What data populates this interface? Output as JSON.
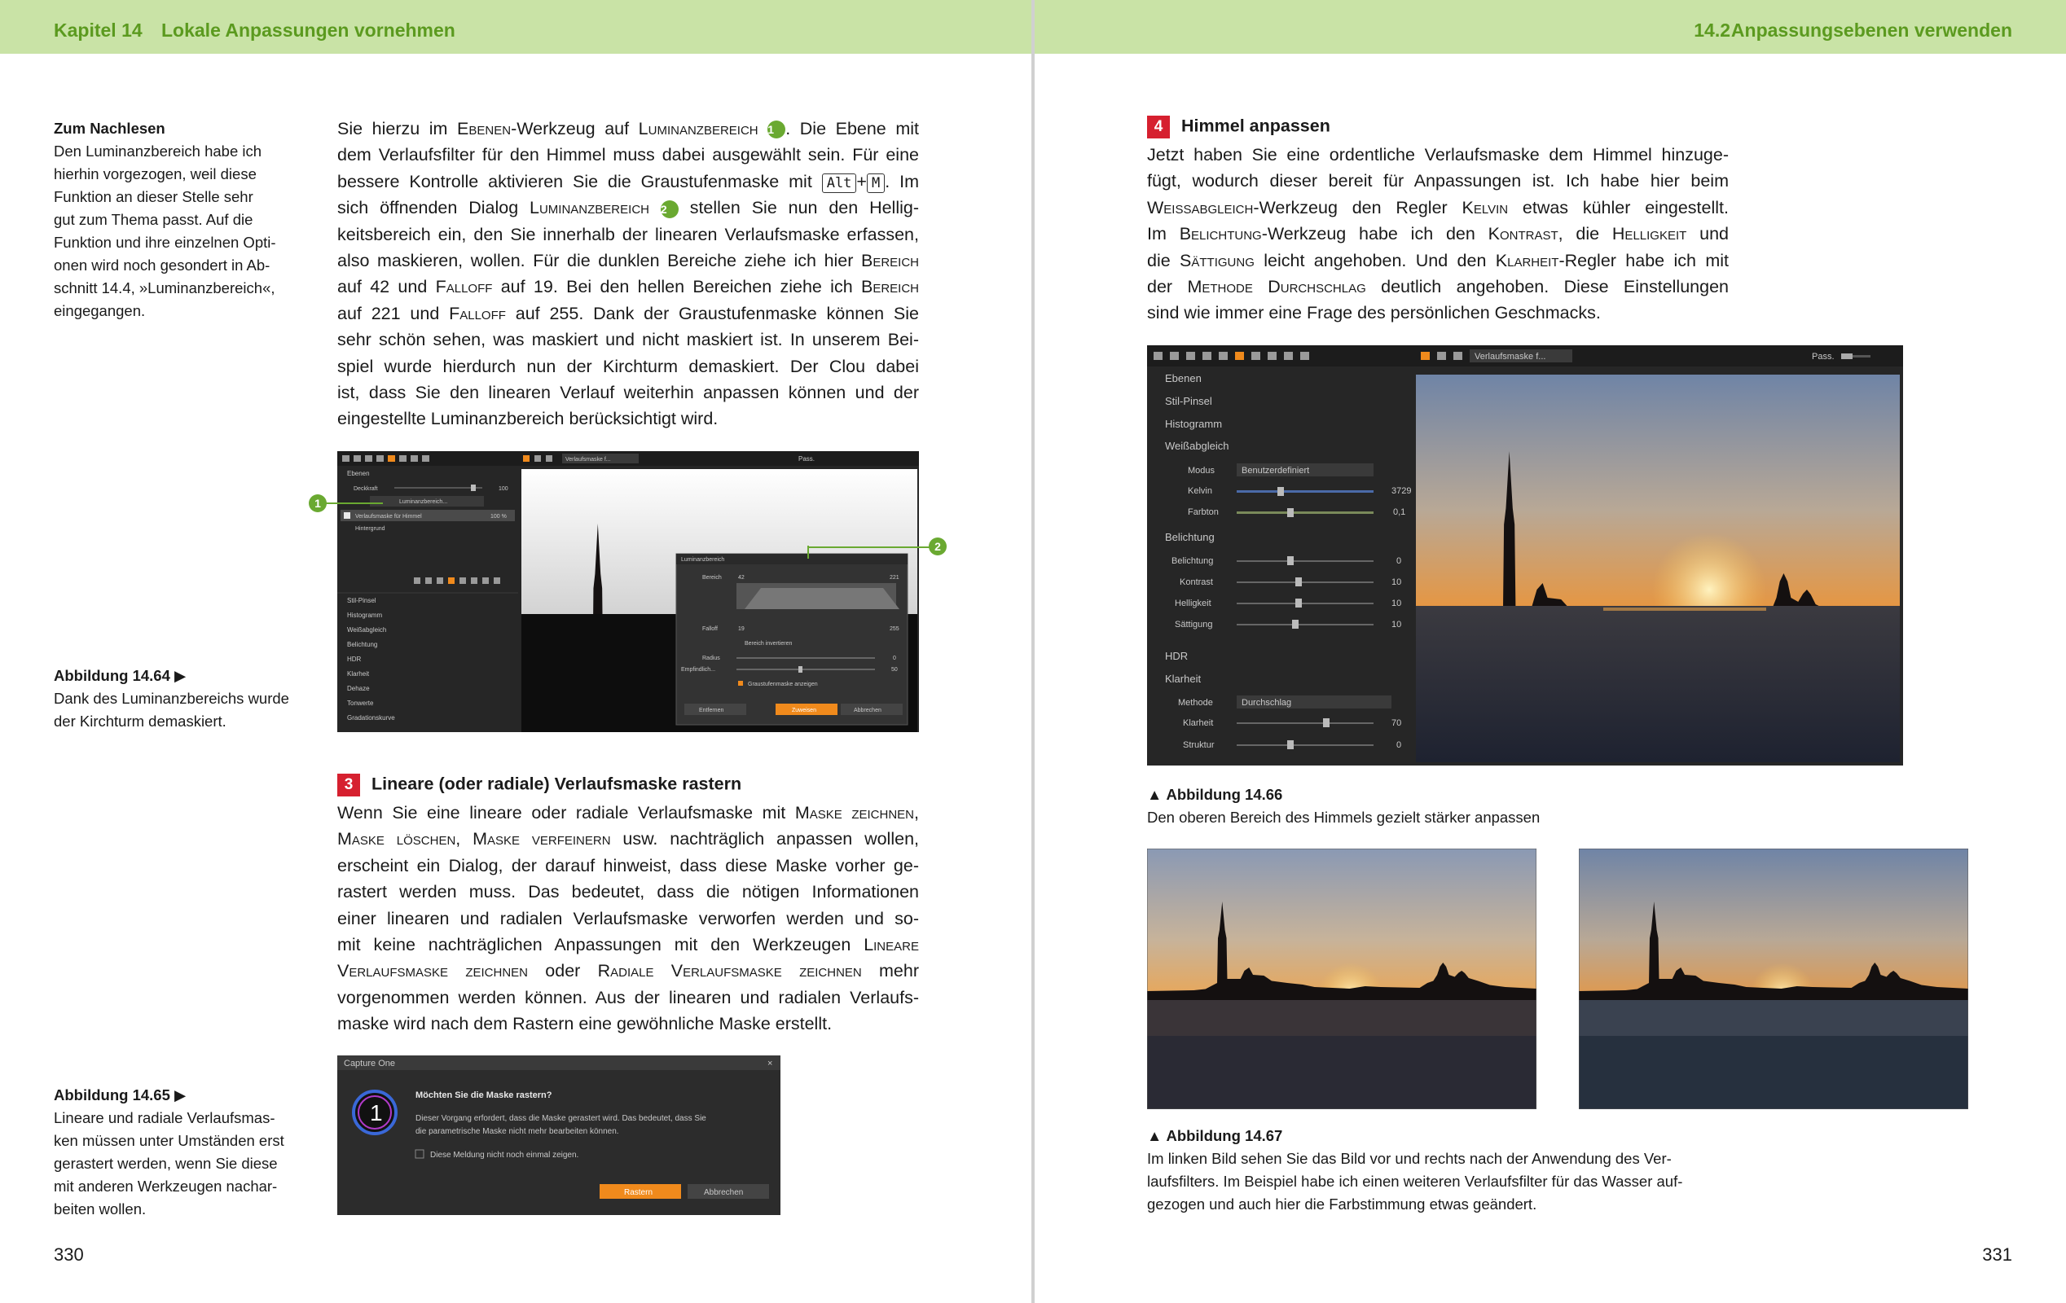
{
  "left_page": {
    "header": {
      "chapter": "Kapitel 14",
      "title": "Lokale Anpassungen vornehmen"
    },
    "note_reading": {
      "title": "Zum Nachlesen",
      "lines": [
        "Den Luminanzbereich habe ich",
        "hierhin vorgezogen, weil diese",
        "Funktion an dieser Stelle sehr",
        "gut zum Thema passt. Auf die",
        "Funktion und ihre einzelnen Opti-",
        "onen wird noch gesondert in Ab-",
        "schnitt 14.4, »Luminanzbereich«,",
        "eingegangen."
      ]
    },
    "para1": {
      "line1_a": "Sie hierzu im ",
      "line1_sc1": "Ebenen",
      "line1_b": "-Werkzeug auf ",
      "line1_sc2": "Luminanzbereich",
      "marker1": "1",
      "line1_c": ". Die Ebene mit",
      "line2": "dem Verlaufsfilter für den Himmel muss dabei ausgewählt sein. Für eine",
      "line3_a": "bessere Kontrolle aktivieren Sie die Graustufenmaske mit ",
      "key_alt": "Alt",
      "plus": "+",
      "key_m": "M",
      "line3_b": ". Im",
      "line4_a": "sich öffnenden Dialog ",
      "line4_sc": "Luminanzbereich",
      "marker2": "2",
      "line4_b": " stellen Sie nun den Hellig-",
      "line5": "keitsbereich ein, den Sie innerhalb der linearen Verlaufsmaske erfassen,",
      "line6_a": "also maskieren, wollen. Für die dunklen Bereiche ziehe ich hier ",
      "line6_sc": "Bereich",
      "line7_a": "auf 42 und ",
      "line7_sc1": "Falloff",
      "line7_b": " auf 19. Bei den hellen Bereichen ziehe ich ",
      "line7_sc2": "Bereich",
      "line8_a": "auf 221 und ",
      "line8_sc": "Falloff",
      "line8_b": " auf 255. Dank der Graustufenmaske können Sie",
      "line9": "sehr schön sehen, was maskiert und nicht maskiert ist. In unserem Bei-",
      "line10": "spiel wurde hierdurch nun der Kirchturm demaskiert. Der Clou dabei",
      "line11": "ist, dass Sie den linearen Verlauf weiterhin anpassen können und der",
      "line12": "eingestellte Luminanzbereich berücksichtigt wird."
    },
    "fig64": {
      "label": "Abbildung 14.64",
      "arrow": "▶",
      "lines": [
        "Dank des Luminanzbereichs wurde",
        "der Kirchturm demaskiert."
      ],
      "callout1": "1",
      "callout2": "2",
      "ui": {
        "layers_title": "Ebenen",
        "opacity_label": "Deckkraft",
        "opacity_value": "100",
        "luminance_button": "Luminanzbereich...",
        "layer1": "Verlaufsmaske für Himmel",
        "layer1_pct": "100 %",
        "layer2": "Hintergrund",
        "tools": [
          "Stil-Pinsel",
          "Histogramm",
          "Weißabgleich",
          "Belichtung",
          "HDR",
          "Klarheit",
          "Dehaze",
          "Tonwerte",
          "Gradationskurve"
        ],
        "viewer_dropdown": "Verlaufsmaske f...",
        "viewer_zoom": "Pass.",
        "dialog_title": "Luminanzbereich",
        "range_label": "Bereich",
        "range_low": "42",
        "range_high": "221",
        "falloff_label": "Falloff",
        "falloff_low": "19",
        "falloff_high": "255",
        "invert_label": "Bereich invertieren",
        "radius_label": "Radius",
        "radius_value": "0",
        "sensitivity_label": "Empfindlich...",
        "sensitivity_value": "50",
        "show_gray_label": "Graustufenmaske anzeigen",
        "btn_remove": "Entfernen",
        "btn_apply": "Zuweisen",
        "btn_cancel": "Abbrechen"
      }
    },
    "step3": {
      "number": "3",
      "title": "Lineare (oder radiale) Verlaufsmaske rastern",
      "line1_a": "Wenn Sie eine lineare oder radiale Verlaufsmaske mit ",
      "line1_sc": "Maske zeichnen",
      "line2_sc1": "Maske löschen",
      "line2_a": ", ",
      "line2_sc2": "Maske verfeinern",
      "line2_b": " usw. nachträglich anpassen wollen,",
      "line3": "erscheint ein Dialog, der darauf hinweist, dass diese Maske vorher ge-",
      "line4": "rastert werden muss. Das bedeutet, dass die nötigen Informationen",
      "line5": "einer linearen und radialen Verlaufsmaske verworfen werden und so-",
      "line6_a": "mit keine nachträglichen Anpassungen mit den Werkzeugen ",
      "line6_sc": "Lineare",
      "line7_sc1": "Verlaufsmaske zeichnen",
      "line7_a": " oder ",
      "line7_sc2": "Radiale Verlaufsmaske zeichnen",
      "line7_b": " mehr",
      "line8": "vorgenommen werden können. Aus der linearen und radialen Verlaufs-",
      "line9": "maske wird nach dem Rastern eine gewöhnliche Maske erstellt."
    },
    "fig65": {
      "label": "Abbildung 14.65",
      "arrow": "▶",
      "lines": [
        "Lineare und radiale Verlaufsmas-",
        "ken müssen unter Umständen erst",
        "gerastert werden, wenn Sie diese",
        "mit anderen Werkzeugen nachar-",
        "beiten wollen."
      ],
      "dialog": {
        "window_title": "Capture One",
        "logo_glyph": "1",
        "question": "Möchten Sie die Maske rastern?",
        "text1": "Dieser Vorgang erfordert, dass die Maske gerastert wird. Das bedeutet, dass Sie",
        "text2": "die parametrische Maske nicht mehr bearbeiten können.",
        "checkbox": "Diese Meldung nicht noch einmal zeigen.",
        "btn_raster": "Rastern",
        "btn_cancel": "Abbrechen"
      }
    },
    "page_number": "330"
  },
  "right_page": {
    "header": {
      "section": "14.2",
      "title": "Anpassungsebenen verwenden"
    },
    "step4": {
      "number": "4",
      "title": "Himmel anpassen",
      "line1": "Jetzt haben Sie eine ordentliche Verlaufsmaske dem Himmel hinzuge-",
      "line2": "fügt, wodurch dieser bereit für Anpassungen ist. Ich habe hier beim",
      "line3_sc1": "Weissabgleich",
      "line3_a": "-Werkzeug den Regler ",
      "line3_sc2": "Kelvin",
      "line3_b": " etwas kühler eingestellt.",
      "line4_a": "Im ",
      "line4_sc1": "Belichtung",
      "line4_b": "-Werkzeug habe ich den ",
      "line4_sc2": "Kontrast",
      "line4_c": ", die ",
      "line4_sc3": "Helligkeit",
      "line4_d": " und",
      "line5_a": "die ",
      "line5_sc1": "Sättigung",
      "line5_b": " leicht angehoben. Und den ",
      "line5_sc2": "Klarheit",
      "line5_c": "-Regler habe ich mit",
      "line6_a": "der ",
      "line6_sc": "Methode Durchschlag",
      "line6_b": " deutlich angehoben. Diese Einstellungen",
      "line7": "sind wie immer eine Frage des persönlichen Geschmacks."
    },
    "fig66": {
      "label": "Abbildung 14.66",
      "arrow": "▲",
      "text": "Den oberen Bereich des Himmels gezielt stärker anpassen",
      "ui": {
        "panel_items": [
          "Ebenen",
          "Stil-Pinsel",
          "Histogramm"
        ],
        "wb_title": "Weißabgleich",
        "mode_label": "Modus",
        "mode_value": "Benutzerdefiniert",
        "kelvin_label": "Kelvin",
        "kelvin_value": "3729",
        "tint_label": "Farbton",
        "tint_value": "0,1",
        "exposure_title": "Belichtung",
        "sliders": [
          {
            "label": "Belichtung",
            "value": "0"
          },
          {
            "label": "Kontrast",
            "value": "10"
          },
          {
            "label": "Helligkeit",
            "value": "10"
          },
          {
            "label": "Sättigung",
            "value": "10"
          }
        ],
        "hdr_title": "HDR",
        "clarity_title": "Klarheit",
        "method_label": "Methode",
        "method_value": "Durchschlag",
        "clarity_label": "Klarheit",
        "clarity_value": "70",
        "structure_label": "Struktur",
        "structure_value": "0",
        "viewer_dropdown": "Verlaufsmaske f...",
        "viewer_zoom": "Pass."
      }
    },
    "fig67": {
      "label": "Abbildung 14.67",
      "arrow": "▲",
      "lines": [
        "Im linken Bild sehen Sie das Bild vor und rechts nach der Anwendung des Ver-",
        "laufsfilters. Im Beispiel habe ich einen weiteren Verlaufsfilter für das Wasser auf-",
        "gezogen und auch hier die Farbstimmung etwas geändert."
      ]
    },
    "page_number": "331"
  }
}
